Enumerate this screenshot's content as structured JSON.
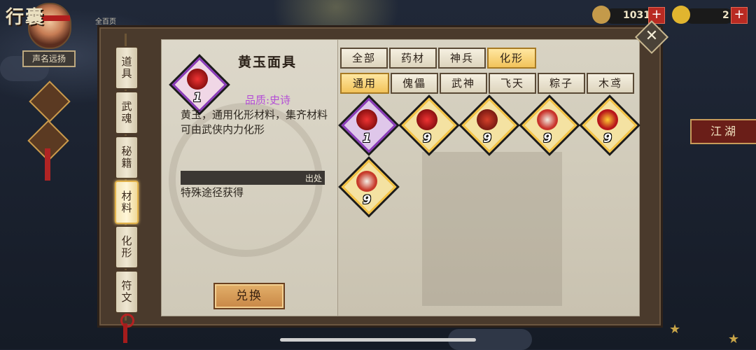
{
  "hud": {
    "title": "行囊",
    "renown_label": "声名远扬",
    "peak_label": "全百页",
    "coins": "1031",
    "gold": "2",
    "side_banner": "江湖"
  },
  "side_tabs": [
    {
      "label": "道具",
      "active": false
    },
    {
      "label": "武魂",
      "active": false
    },
    {
      "label": "秘籍",
      "active": false
    },
    {
      "label": "材料",
      "active": true
    },
    {
      "label": "化形",
      "active": false
    },
    {
      "label": "符文",
      "active": false
    }
  ],
  "detail": {
    "name": "黄玉面具",
    "count": "1",
    "quality": "品质:史诗",
    "description": "黄玉，通用化形材料，集齐材料可由武侠内力化形",
    "source_label": "出处",
    "source_text": "特殊途径获得",
    "exchange_button": "兑换"
  },
  "top_tabs": [
    {
      "label": "全部",
      "active": false
    },
    {
      "label": "药材",
      "active": false
    },
    {
      "label": "神兵",
      "active": false
    },
    {
      "label": "化形",
      "active": true
    }
  ],
  "sub_tabs": [
    {
      "label": "通用",
      "active": true
    },
    {
      "label": "傀儡",
      "active": false
    },
    {
      "label": "武神",
      "active": false
    },
    {
      "label": "飞天",
      "active": false
    },
    {
      "label": "粽子",
      "active": false
    },
    {
      "label": "木鸢",
      "active": false
    }
  ],
  "items": [
    {
      "count": "1",
      "icon": "demon-mask-icon",
      "frame_color": "#8a3cb8"
    },
    {
      "count": "9",
      "icon": "demon-mask-icon",
      "frame_color": "#f3c246"
    },
    {
      "count": "9",
      "icon": "red-beast-icon",
      "frame_color": "#f3c246"
    },
    {
      "count": "9",
      "icon": "lion-mask-icon",
      "frame_color": "#f3c246"
    },
    {
      "count": "9",
      "icon": "flame-mask-icon",
      "frame_color": "#f3c246"
    },
    {
      "count": "9",
      "icon": "crane-mask-icon",
      "frame_color": "#f3c246"
    }
  ]
}
